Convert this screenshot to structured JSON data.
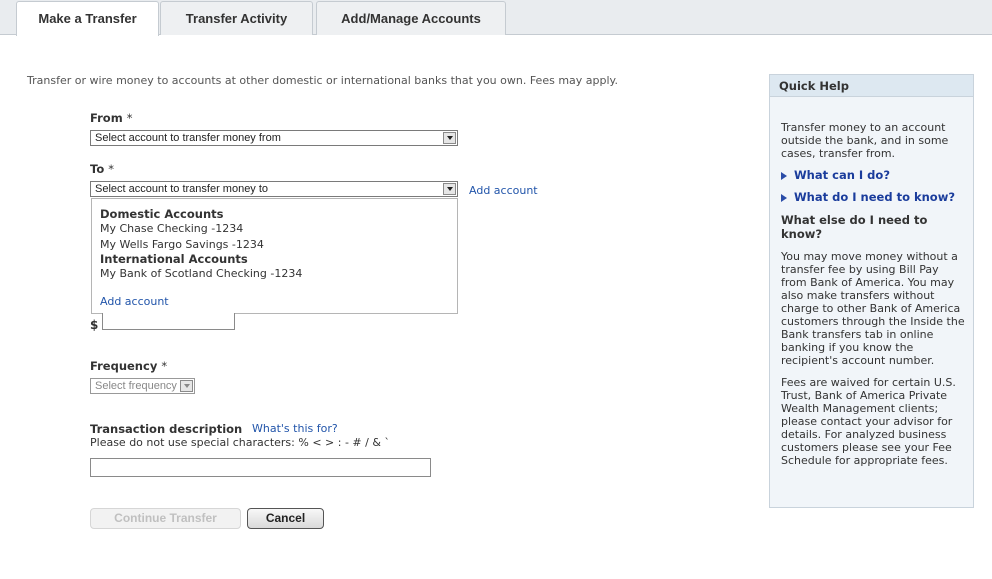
{
  "tabs": [
    {
      "label": "Make a Transfer",
      "active": true
    },
    {
      "label": "Transfer Activity",
      "active": false
    },
    {
      "label": "Add/Manage Accounts",
      "active": false
    }
  ],
  "intro": "Transfer or wire money to accounts at other domestic or international banks that you own. Fees may apply.",
  "from": {
    "label": "From",
    "required": "*",
    "selected": "Select account to transfer money from"
  },
  "to": {
    "label": "To",
    "required": "*",
    "selected": "Select account to transfer money to",
    "add_account": "Add account"
  },
  "dropdown": {
    "groups": [
      {
        "name": "Domestic Accounts",
        "options": [
          "My Chase Checking -1234",
          "My Wells Fargo Savings -1234"
        ]
      },
      {
        "name": "International Accounts",
        "options": [
          "My Bank of Scotland Checking -1234"
        ]
      }
    ],
    "add_account": "Add account"
  },
  "amount": {
    "currency": "$",
    "value": ""
  },
  "frequency": {
    "label": "Frequency",
    "required": "*",
    "selected": "Select frequency"
  },
  "description": {
    "label": "Transaction description",
    "help_link": "What's this for?",
    "note": "Please do not use special characters: % < > : - # / & `",
    "value": ""
  },
  "buttons": {
    "continue": "Continue Transfer",
    "cancel": "Cancel"
  },
  "quick_help": {
    "title": "Quick Help",
    "intro": "Transfer money to an account outside the bank, and in some cases, transfer from.",
    "links": [
      "What can I do?",
      "What do I need to know?"
    ],
    "subheading": "What else do I need to know?",
    "paragraphs": [
      "You may move money without a transfer fee by using Bill Pay from Bank of America. You may also make transfers without charge to other Bank of America customers through the Inside the Bank transfers tab in online banking if you know the recipient's account number.",
      "Fees are waived for certain U.S. Trust, Bank of America Private Wealth Management clients; please contact your advisor for details. For analyzed business customers please see your Fee Schedule for appropriate fees."
    ]
  },
  "colors": {
    "link": "#2255aa",
    "help_link": "#1a3c9c",
    "help_header": "#dde8f1"
  }
}
